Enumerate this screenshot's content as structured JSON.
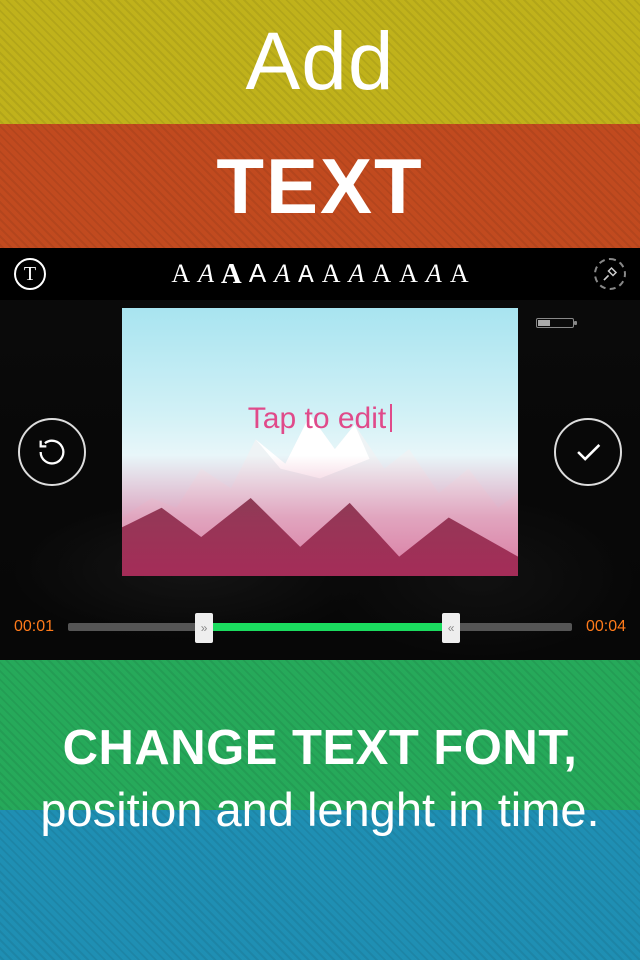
{
  "promo": {
    "title_line1": "Add",
    "title_line2": "TEXT",
    "caption_line1": "CHANGE TEXT FONT,",
    "caption_line2": "position and lenght in time."
  },
  "colors": {
    "yellow": "#c0b21b",
    "orange": "#c14a1f",
    "green": "#26a95a",
    "blue": "#1f8fb3",
    "timeline_sel": "#1bdc5f",
    "time_label": "#ff7a1a",
    "placeholder": "#e04a8a"
  },
  "editor": {
    "toolbar": {
      "text_tool_glyph": "T",
      "font_samples": [
        "A",
        "A",
        "A",
        "A",
        "A",
        "A",
        "A",
        "A",
        "A",
        "A",
        "A",
        "A"
      ],
      "font_selected_index": 2
    },
    "canvas": {
      "placeholder": "Tap to edit"
    },
    "timeline": {
      "start_label": "00:01",
      "end_label": "00:04",
      "range_start_pct": 27,
      "range_end_pct": 76
    }
  }
}
